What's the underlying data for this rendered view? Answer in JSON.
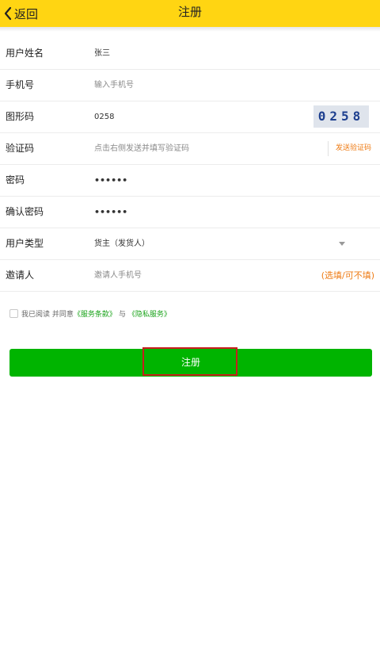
{
  "header": {
    "back_label": "返回",
    "title": "注册",
    "background": "#ffd512"
  },
  "form": {
    "username": {
      "label": "用户姓名",
      "value": "张三"
    },
    "phone": {
      "label": "手机号",
      "placeholder": "输入手机号"
    },
    "captcha": {
      "label": "图形码",
      "value": "0258",
      "image_text": "0258"
    },
    "verify_code": {
      "label": "验证码",
      "placeholder": "点击右侧发送并填写验证码",
      "send_label": "发送验证码"
    },
    "password": {
      "label": "密码",
      "value": "••••••"
    },
    "confirm_password": {
      "label": "确认密码",
      "value": "••••••"
    },
    "user_type": {
      "label": "用户类型",
      "value": "货主（发货人）"
    },
    "inviter": {
      "label": "邀请人",
      "placeholder": "邀请人手机号",
      "note": "(选填/可不填)"
    }
  },
  "agreement": {
    "text_before": "我已阅读 并同意",
    "terms_link": "《服务条款》",
    "connector": "与",
    "privacy_link": "《隐私服务》",
    "checked": false
  },
  "submit": {
    "label": "注册",
    "color": "#00b400"
  },
  "colors": {
    "accent_orange": "#ee7b14",
    "link_green": "#1aa31a",
    "highlight_red": "#c81e1e"
  }
}
